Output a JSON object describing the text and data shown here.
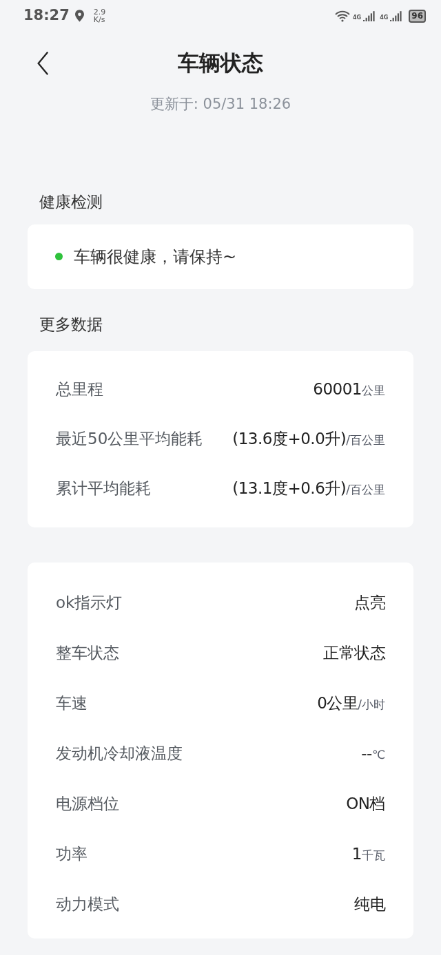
{
  "status_bar": {
    "time": "18:27",
    "speed_value": "2.9",
    "speed_unit": "K/s",
    "network_1": "4G",
    "network_2": "4G",
    "battery": "96"
  },
  "header": {
    "title": "车辆状态",
    "updated": "更新于: 05/31 18:26"
  },
  "health": {
    "heading": "健康检测",
    "status": {
      "text": "车辆很健康，请保持~",
      "color": "#2fc23c"
    }
  },
  "more_data": {
    "heading": "更多数据",
    "rows": [
      {
        "label": "总里程",
        "value": "60001",
        "unit": "公里"
      },
      {
        "label": "最近50公里平均能耗",
        "value": "(13.6度+0.0升)",
        "unit": "/百公里"
      },
      {
        "label": "累计平均能耗",
        "value": "(13.1度+0.6升)",
        "unit": "/百公里"
      }
    ]
  },
  "vehicle": {
    "rows": [
      {
        "label": "ok指示灯",
        "value": "点亮"
      },
      {
        "label": "整车状态",
        "value": "正常状态"
      },
      {
        "label": "车速",
        "value": "0公里",
        "unit": "/小时"
      },
      {
        "label": "发动机冷却液温度",
        "value": "--",
        "unit": "℃"
      },
      {
        "label": "电源档位",
        "value": "ON档"
      },
      {
        "label": "功率",
        "value": "1",
        "unit": "千瓦"
      },
      {
        "label": "动力模式",
        "value": "纯电"
      }
    ]
  }
}
